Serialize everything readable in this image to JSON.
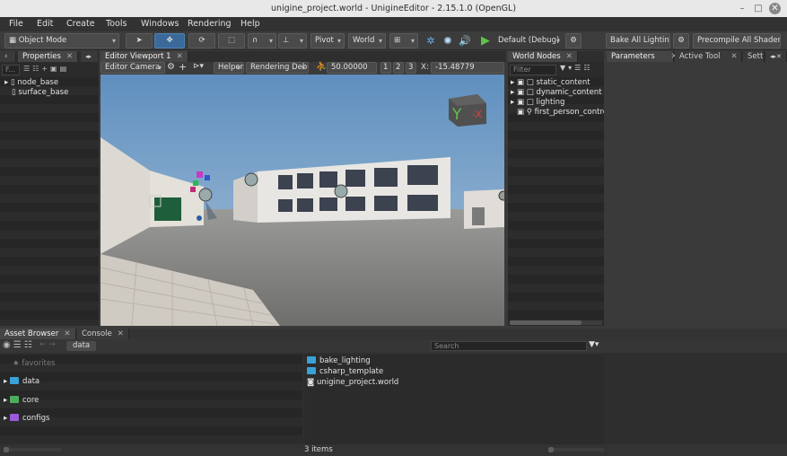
{
  "window": {
    "title": "unigine_project.world - UnigineEditor - 2.15.1.0 (OpenGL)",
    "min": "–",
    "max": "□",
    "close": "✕"
  },
  "menu": [
    "File",
    "Edit",
    "Create",
    "Tools",
    "Windows",
    "Rendering",
    "Help"
  ],
  "toolbar": {
    "mode": "Object Mode",
    "pivot": "Pivot",
    "space": "World",
    "preset": "Default (Debug)",
    "bake": "Bake All Lighting",
    "precompile": "Precompile All Shaders"
  },
  "properties": {
    "tab": "Properties",
    "search_placeholder": "F...",
    "items": [
      "node_base",
      "surface_base"
    ]
  },
  "viewport": {
    "tab": "Editor Viewport 1",
    "camera": "Editor Camera",
    "helpers": "Helpers",
    "rendering_debug": "Rendering Debug",
    "speed": "50.00000",
    "b1": "1",
    "b2": "2",
    "b3": "3",
    "x_label": "X:",
    "x_value": "-15.48779",
    "gizmo_y": "Y",
    "gizmo_x": "-X"
  },
  "world_nodes": {
    "tab": "World Nodes",
    "filter_placeholder": "Filter",
    "items": [
      "static_content",
      "dynamic_content",
      "lighting",
      "first_person_controller"
    ]
  },
  "right_tabs": [
    "Parameters",
    "Active Tool",
    "Settings"
  ],
  "bottom": {
    "tabs": [
      "Asset Browser",
      "Console"
    ],
    "path": "data",
    "search_placeholder": "Search",
    "tree": [
      "favorites",
      "data",
      "core",
      "configs"
    ],
    "files": [
      "bake_lighting",
      "csharp_template",
      "unigine_project.world"
    ],
    "status": "3 items"
  },
  "colors": {
    "accent": "#3b6a9a",
    "folder_blue": "#3aa0d8",
    "folder_green": "#4cae5a",
    "folder_purple": "#9a5ad8",
    "play_green": "#5ec24a"
  }
}
